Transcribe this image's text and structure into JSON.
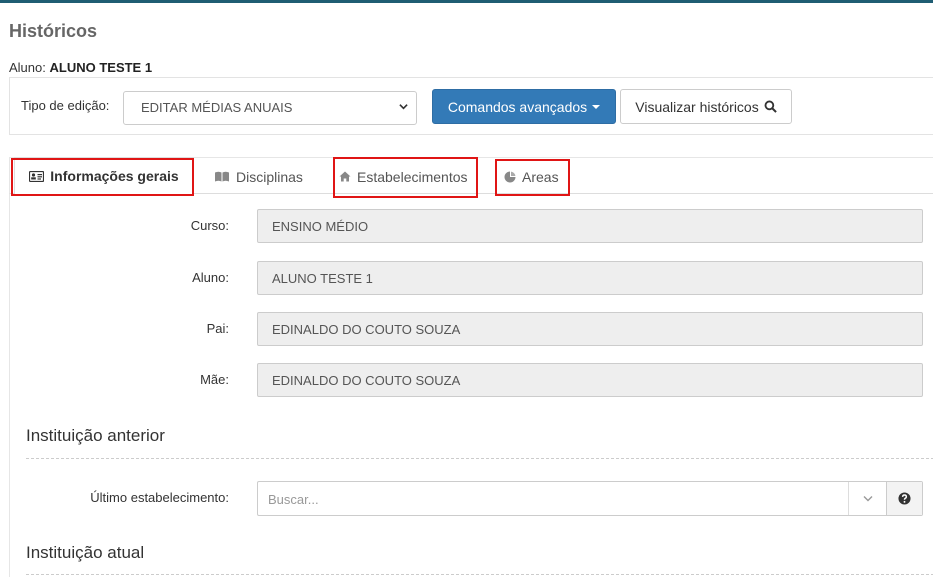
{
  "page": {
    "title": "Históricos",
    "student_label": "Aluno:",
    "student_name": "ALUNO TESTE 1"
  },
  "toolbar": {
    "edit_type_label": "Tipo de edição:",
    "edit_type_value": "EDITAR MÉDIAS ANUAIS",
    "advanced_button": "Comandos avançados",
    "view_button": "Visualizar históricos"
  },
  "tabs": [
    {
      "label": "Informações gerais",
      "icon": "id-card-icon",
      "active": true
    },
    {
      "label": "Disciplinas",
      "icon": "book-icon",
      "active": false
    },
    {
      "label": "Estabelecimentos",
      "icon": "home-icon",
      "active": false
    },
    {
      "label": "Areas",
      "icon": "pie-chart-icon",
      "active": false
    }
  ],
  "form": {
    "curso": {
      "label": "Curso:",
      "value": "ENSINO MÉDIO"
    },
    "aluno": {
      "label": "Aluno:",
      "value": "ALUNO TESTE 1"
    },
    "pai": {
      "label": "Pai:",
      "value": "EDINALDO DO COUTO SOUZA"
    },
    "mae": {
      "label": "Mãe:",
      "value": "EDINALDO DO COUTO SOUZA"
    }
  },
  "instituicao_anterior": {
    "title": "Instituição anterior",
    "last_label": "Último estabelecimento:",
    "search_placeholder": "Buscar..."
  },
  "instituicao_atual": {
    "title": "Instituição atual"
  },
  "colors": {
    "primary": "#337ab7",
    "highlight": "#e01515",
    "top_bar": "#1f5d73"
  }
}
